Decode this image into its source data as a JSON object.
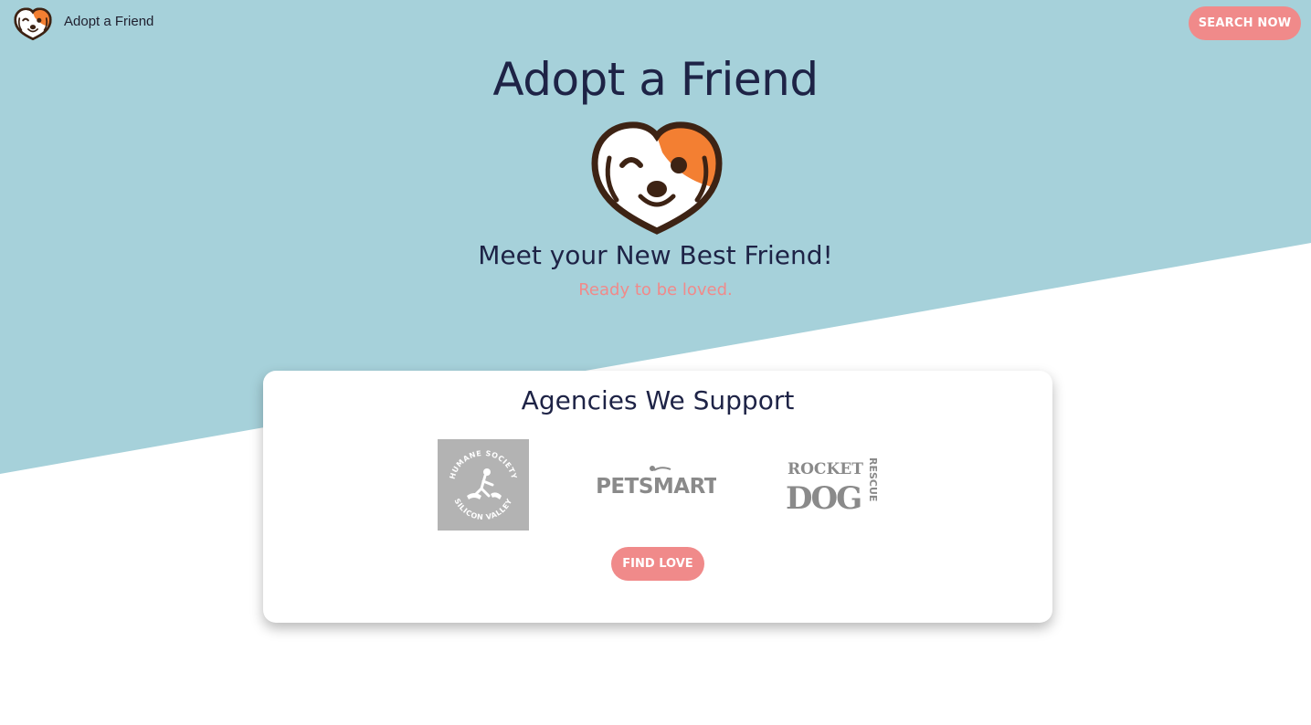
{
  "nav": {
    "title": "Adopt a Friend",
    "logo_icon": "dog-heart-logo-icon",
    "search_label": "SEARCH NOW"
  },
  "hero": {
    "title": "Adopt a Friend",
    "logo_icon": "dog-heart-logo-icon",
    "subtitle": "Meet your New Best Friend!",
    "tagline": "Ready to be loved."
  },
  "agencies": {
    "title": "Agencies We Support",
    "items": [
      {
        "name": "Humane Society Silicon Valley",
        "logo_text_top": "HUMANE SOCIETY",
        "logo_text_bottom": "SILICON VALLEY"
      },
      {
        "name": "PetSmart",
        "logo_text": "PETSMART"
      },
      {
        "name": "Rocket Dog Rescue",
        "logo_text_top": "ROCKET",
        "logo_text_main": "DOG",
        "logo_text_side": "RESCUE"
      }
    ],
    "cta_label": "FIND LOVE"
  },
  "colors": {
    "hero_bg": "#a6d1da",
    "accent": "#f08a8a",
    "heading": "#1e2346",
    "logo_orange": "#f37f32",
    "logo_brown": "#3d2314",
    "agency_gray": "#b3b3b3"
  }
}
